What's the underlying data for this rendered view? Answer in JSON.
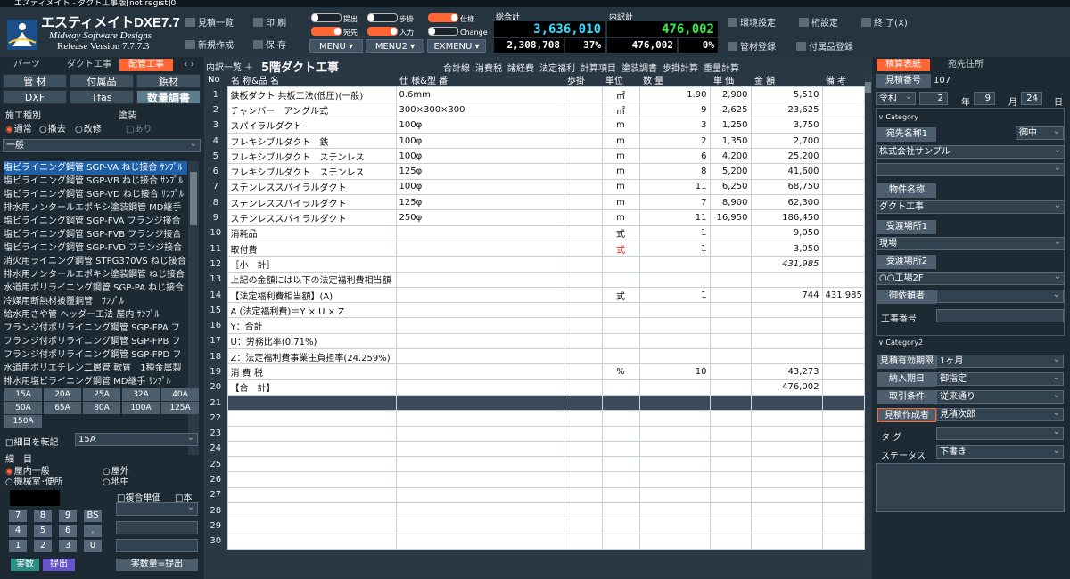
{
  "title_bar": "エスティメイト - ダクト工事版[not regist]0",
  "app": {
    "name": "エスティメイトDXE7.7",
    "company": "Midway Software Designs",
    "version": "Release Version 7.7.7.3"
  },
  "toolbar": {
    "list": "見積一覧",
    "print": "印 刷",
    "new": "新規作成",
    "save": "保 存",
    "env": "環境設定",
    "digit": "桁設定",
    "exit": "終 了(X)",
    "pipe_reg": "管材登録",
    "part_reg": "付属品登録",
    "menu": "MENU",
    "menu2": "MENU2",
    "exmenu": "EXMENU"
  },
  "toggles": {
    "submit": "提出",
    "step": "歩掛",
    "spec": "仕様",
    "dest": "宛先",
    "input": "入力",
    "change": "Change"
  },
  "totals": {
    "grand_label": "総合計",
    "grand": "3,636,010",
    "grand_sub": "2,308,708",
    "grand_pct": "37%",
    "detail_label": "内訳計",
    "detail": "476,002",
    "detail_sub": "476,002",
    "detail_pct": "0%"
  },
  "left": {
    "tabs": [
      "パーツ",
      "ダクト工事",
      "配管工事"
    ],
    "buttons": [
      "管 材",
      "付属品",
      "鋲材",
      "DXF",
      "Tfas",
      "数量調書"
    ],
    "work_type_label": "施工種別",
    "paint_label": "塗装",
    "paint_opt": "□あり",
    "work_types": [
      "通常",
      "撤去",
      "改修"
    ],
    "category": "一般",
    "materials": [
      "塩ビライニング鋼管 SGP-VA ねじ接合 ｻﾝﾌﾟﾙ",
      "塩ビライニング鋼管 SGP-VB ねじ接合 ｻﾝﾌﾟﾙ",
      "塩ビライニング鋼管 SGP-VD ねじ接合 ｻﾝﾌﾟﾙ",
      "排水用ノンタールエポキシ塗装鋼管 MD継手",
      "塩ビライニング鋼管 SGP-FVA フランジ接合",
      "塩ビライニング鋼管 SGP-FVB フランジ接合",
      "塩ビライニング鋼管 SGP-FVD フランジ接合",
      "消火用ライニング鋼管 STPG370VS ねじ接合",
      "排水用ノンタールエポキシ塗装鋼管 ねじ接合",
      "水道用ポリライニング鋼管 SGP-PA ねじ接合",
      "冷媒用断熱材被覆銅管　ｻﾝﾌﾟﾙ",
      "給水用さや管 ヘッダー工法 屋内 ｻﾝﾌﾟﾙ",
      "フランジ付ポリライニング鋼管 SGP-FPA フ",
      "フランジ付ポリライニング鋼管 SGP-FPB フ",
      "フランジ付ポリライニング鋼管 SGP-FPD フ",
      "水道用ポリエチレン二層管 軟質　1種金属製",
      "排水用塩ビライニング鋼管 MD継手 ｻﾝﾌﾟﾙ"
    ],
    "sizes": [
      "15A",
      "20A",
      "25A",
      "32A",
      "40A",
      "50A",
      "65A",
      "80A",
      "100A",
      "125A",
      "150A"
    ],
    "transfer_label": "□細目を転記",
    "transfer_size": "15A",
    "detail_label": "細　目",
    "detail_opts": [
      "屋内一般",
      "屋外",
      "機械室･便所",
      "地中"
    ],
    "composite": "□複合単価",
    "book": "□本",
    "keys": [
      "7",
      "8",
      "9",
      "BS",
      "4",
      "5",
      "6",
      ".",
      "1",
      "2",
      "3",
      "0"
    ],
    "bottom": [
      "実数",
      "提出",
      "実数量=提出"
    ]
  },
  "center": {
    "tab_label": "内訳一覧",
    "title": "5階ダクト工事",
    "menu": [
      "合計線",
      "消費税",
      "諸経費",
      "法定福利",
      "計算項目",
      "塗装調書",
      "歩掛計算",
      "重量計算"
    ],
    "headers": [
      "No",
      "名 称&品 名",
      "仕 様&型 番",
      "歩掛",
      "単位",
      "数 量",
      "単 価",
      "金 額",
      "備 考"
    ],
    "rows": [
      [
        "1",
        "鉄板ダクト 共板工法(低圧)(一般)",
        "0.6mm",
        "",
        "㎡",
        "1.90",
        "2,900",
        "5,510",
        ""
      ],
      [
        "2",
        "チャンバー　アングル式",
        "300×300×300",
        "",
        "㎡",
        "9",
        "2,625",
        "23,625",
        ""
      ],
      [
        "3",
        "スパイラルダクト",
        "100φ",
        "",
        "m",
        "3",
        "1,250",
        "3,750",
        ""
      ],
      [
        "4",
        "フレキシブルダクト　鉄",
        "100φ",
        "",
        "m",
        "2",
        "1,350",
        "2,700",
        ""
      ],
      [
        "5",
        "フレキシブルダクト　ステンレス",
        "100φ",
        "",
        "m",
        "6",
        "4,200",
        "25,200",
        ""
      ],
      [
        "6",
        "フレキシブルダクト　ステンレス",
        "125φ",
        "",
        "m",
        "8",
        "5,200",
        "41,600",
        ""
      ],
      [
        "7",
        "ステンレススパイラルダクト",
        "100φ",
        "",
        "m",
        "11",
        "6,250",
        "68,750",
        ""
      ],
      [
        "8",
        "ステンレススパイラルダクト",
        "125φ",
        "",
        "m",
        "7",
        "8,900",
        "62,300",
        ""
      ],
      [
        "9",
        "ステンレススパイラルダクト",
        "250φ",
        "",
        "m",
        "11",
        "16,950",
        "186,450",
        ""
      ],
      [
        "10",
        "消耗品",
        "",
        "",
        "式",
        "1",
        "",
        "9,050",
        ""
      ],
      [
        "11",
        "取付費",
        "",
        "",
        "式",
        "1",
        "",
        "3,050",
        ""
      ],
      [
        "12",
        "［小　計］",
        "",
        "",
        "",
        "",
        "",
        "431,985",
        ""
      ],
      [
        "13",
        "上記の金額には以下の法定福利費相当額",
        "",
        "",
        "",
        "",
        "",
        "",
        ""
      ],
      [
        "14",
        "【法定福利費相当額】(A)",
        "",
        "",
        "式",
        "1",
        "",
        "744",
        "431,985"
      ],
      [
        "15",
        "A (法定福利費)＝Y × U × Z",
        "",
        "",
        "",
        "",
        "",
        "",
        ""
      ],
      [
        "16",
        "Y：合計",
        "",
        "",
        "",
        "",
        "",
        "",
        ""
      ],
      [
        "17",
        "U：労務比率(0.71%)",
        "",
        "",
        "",
        "",
        "",
        "",
        ""
      ],
      [
        "18",
        "Z：法定福利費事業主負担率(24.259%)",
        "",
        "",
        "",
        "",
        "",
        "",
        ""
      ],
      [
        "19",
        "消 費 税",
        "",
        "",
        "%",
        "10",
        "",
        "43,273",
        ""
      ],
      [
        "20",
        "【合　計】",
        "",
        "",
        "",
        "",
        "",
        "476,002",
        ""
      ],
      [
        "21",
        "",
        "",
        "",
        "",
        "",
        "",
        "",
        ""
      ],
      [
        "22",
        "",
        "",
        "",
        "",
        "",
        "",
        "",
        ""
      ],
      [
        "23",
        "",
        "",
        "",
        "",
        "",
        "",
        "",
        ""
      ],
      [
        "24",
        "",
        "",
        "",
        "",
        "",
        "",
        "",
        ""
      ],
      [
        "25",
        "",
        "",
        "",
        "",
        "",
        "",
        "",
        ""
      ],
      [
        "26",
        "",
        "",
        "",
        "",
        "",
        "",
        "",
        ""
      ],
      [
        "27",
        "",
        "",
        "",
        "",
        "",
        "",
        "",
        ""
      ],
      [
        "28",
        "",
        "",
        "",
        "",
        "",
        "",
        "",
        ""
      ],
      [
        "29",
        "",
        "",
        "",
        "",
        "",
        "",
        "",
        ""
      ],
      [
        "30",
        "",
        "",
        "",
        "",
        "",
        "",
        "",
        ""
      ]
    ]
  },
  "right": {
    "tabs": [
      "積算表紙",
      "宛先住所"
    ],
    "est_no_label": "見積番号",
    "est_no": "107",
    "era": "令和",
    "year": "2",
    "year_lbl": "年",
    "month": "9",
    "month_lbl": "月",
    "day": "24",
    "day_lbl": "日",
    "cat1": "∨ Category",
    "cat2": "∨ Category2",
    "addressee_label": "宛先名称1",
    "honorific": "御中",
    "addressee": "株式会社サンプル",
    "project_label": "物件名称",
    "project": "ダクト工事",
    "site1_label": "受渡場所1",
    "site1": "現場",
    "site2_label": "受渡場所2",
    "site2": "○○工場2F",
    "client_label": "御依頼者",
    "job_label": "工事番号",
    "validity_label": "見積有効期限",
    "validity": "1ヶ月",
    "delivery_label": "納入期日",
    "delivery": "御指定",
    "terms_label": "取引条件",
    "terms": "従来通り",
    "author_label": "見積作成者",
    "author": "見積次郎",
    "tag_label": "タ グ",
    "status_label": "ステータス",
    "status": "下書き"
  }
}
